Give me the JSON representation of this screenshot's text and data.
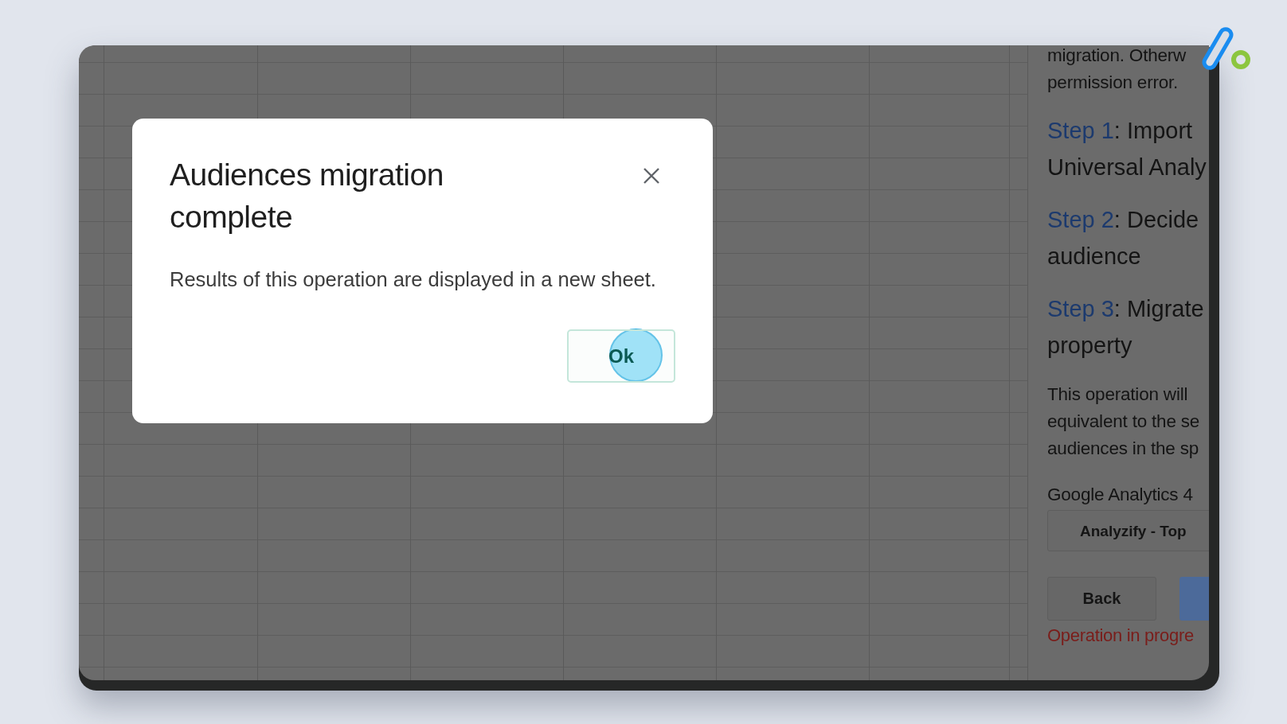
{
  "dialog": {
    "title": "Audiences migration complete",
    "message": "Results of this operation are displayed in a new sheet.",
    "buttons": [
      {
        "label": "Ok",
        "kind": "confirm"
      }
    ]
  },
  "side_panel": {
    "intro_lines": [
      "migration. Otherw",
      "permission error."
    ],
    "steps": [
      {
        "link": "Step 1",
        "lines": [
          ": Import",
          "Universal Analy"
        ]
      },
      {
        "link": "Step 2",
        "lines": [
          ": Decide",
          "audience"
        ]
      },
      {
        "link": "Step 3",
        "lines": [
          ": Migrate",
          "property"
        ]
      }
    ],
    "description_lines": [
      "This operation will",
      "equivalent to the se",
      "audiences in the sp"
    ],
    "property_label": "Google Analytics 4",
    "property_select": "Analyzify - Top",
    "buttons": [
      {
        "kind": "secondary",
        "label": "Back"
      },
      {
        "kind": "primary"
      }
    ],
    "status": "Operation in progre"
  }
}
